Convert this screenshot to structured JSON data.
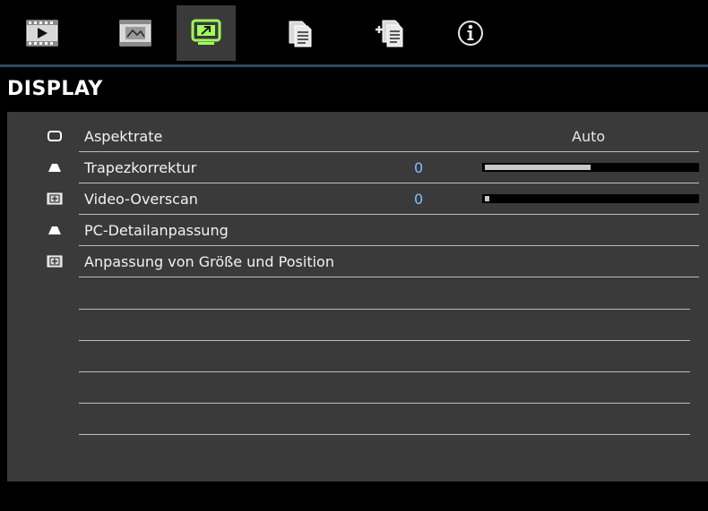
{
  "tabs": [
    {
      "name": "image-tab",
      "icon": "film-play-icon"
    },
    {
      "name": "setup-tab",
      "icon": "picture-frame-icon"
    },
    {
      "name": "display-tab",
      "icon": "monitor-icon",
      "active": true
    },
    {
      "name": "settings-tab",
      "icon": "documents-icon"
    },
    {
      "name": "advanced-tab",
      "icon": "documents-plus-icon"
    },
    {
      "name": "info-tab",
      "icon": "info-circle-icon"
    }
  ],
  "page": {
    "title": "DISPLAY"
  },
  "menu": {
    "items": [
      {
        "label": "Aspektrate",
        "value": "Auto",
        "icon": "aspect-rect-icon"
      },
      {
        "label": "Trapezkorrektur",
        "value": "0",
        "slider": 0.5,
        "icon": "trapezoid-icon"
      },
      {
        "label": "Video-Overscan",
        "value": "0",
        "slider": 0.02,
        "icon": "overscan-icon"
      },
      {
        "label": "PC-Detailanpassung",
        "icon": "trapezoid-icon"
      },
      {
        "label": "Anpassung von Größe und Position",
        "icon": "overscan-icon"
      }
    ]
  },
  "colors": {
    "accent": "#a0ff5a",
    "value": "#7fbfff",
    "panel": "#3a3a3a"
  }
}
